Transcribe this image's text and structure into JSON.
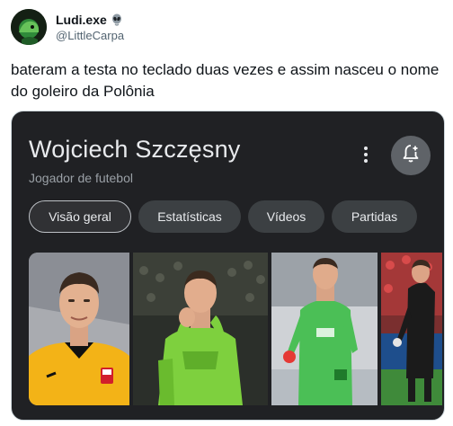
{
  "tweet": {
    "author_name": "Ludi.exe",
    "author_handle": "@LittleCarpa",
    "text": "bateram a testa no teclado duas vezes e assim nasceu o nome do goleiro da Polônia"
  },
  "knowledge_panel": {
    "title": "Wojciech Szczęsny",
    "subtitle": "Jogador de futebol",
    "chips": [
      {
        "label": "Visão geral",
        "active": true
      },
      {
        "label": "Estatísticas",
        "active": false
      },
      {
        "label": "Vídeos",
        "active": false
      },
      {
        "label": "Partidas",
        "active": false
      }
    ],
    "icons": {
      "more": "more-vert-icon",
      "follow": "add-notification-icon"
    },
    "images": [
      {
        "description": "portrait-yellow-kit"
      },
      {
        "description": "clapping-green-kit"
      },
      {
        "description": "green-kit-stadium"
      },
      {
        "description": "black-kit-match"
      }
    ]
  },
  "colors": {
    "panel_bg": "#202124",
    "chip_bg": "#3c4043",
    "text_primary": "#e8eaed",
    "text_secondary": "#9aa0a6"
  }
}
